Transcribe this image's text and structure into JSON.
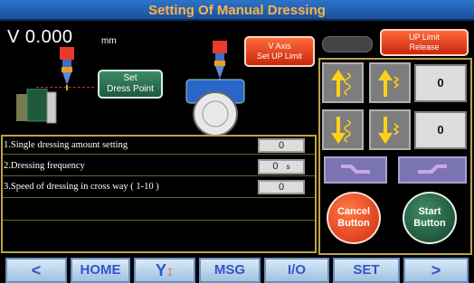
{
  "title": "Setting Of Manual Dressing",
  "readout": {
    "value": "V 0.000",
    "unit": "mm"
  },
  "buttons": {
    "set_dress_point": "Set\nDress Point",
    "v_axis_set_up_limit": "V Axis\nSet UP Limit",
    "up_limit_release": "UP Limit\nRelease",
    "cancel": "Cancel\nButton",
    "start": "Start\nButton"
  },
  "settings": [
    {
      "label": "1.Single dressing amount setting",
      "value": "0",
      "unit": ""
    },
    {
      "label": "2.Dressing frequency",
      "value": "0",
      "unit": "s"
    },
    {
      "label": "3.Speed of dressing in cross way ( 1-10 )",
      "value": "0",
      "unit": ""
    }
  ],
  "jog": {
    "up_value": "0",
    "down_value": "0"
  },
  "nav": [
    "<",
    "HOME",
    "Y",
    "MSG",
    "I/O",
    "SET",
    ">"
  ],
  "colors": {
    "title_text": "#ffb347",
    "panel_border": "#b9a24a",
    "accent_red": "#e8401c",
    "accent_green": "#2a6e50"
  }
}
